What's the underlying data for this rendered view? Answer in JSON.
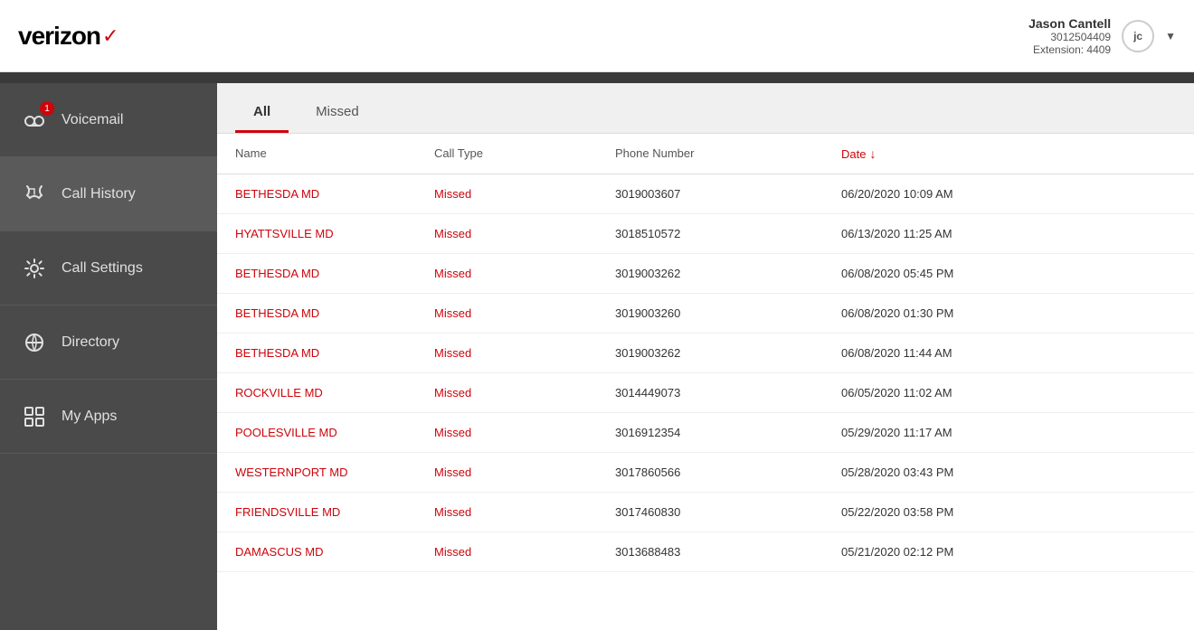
{
  "header": {
    "logo_text": "verizon",
    "user_name": "Jason Cantell",
    "user_phone": "3012504409",
    "user_ext": "Extension: 4409",
    "avatar_initials": "jc"
  },
  "sidebar": {
    "items": [
      {
        "id": "voicemail",
        "label": "Voicemail",
        "badge": "1",
        "active": false
      },
      {
        "id": "call-history",
        "label": "Call History",
        "badge": null,
        "active": true
      },
      {
        "id": "call-settings",
        "label": "Call Settings",
        "badge": null,
        "active": false
      },
      {
        "id": "directory",
        "label": "Directory",
        "badge": null,
        "active": false
      },
      {
        "id": "my-apps",
        "label": "My Apps",
        "badge": null,
        "active": false
      }
    ]
  },
  "tabs": [
    {
      "id": "all",
      "label": "All",
      "active": true
    },
    {
      "id": "missed",
      "label": "Missed",
      "active": false
    }
  ],
  "table": {
    "columns": [
      {
        "id": "name",
        "label": "Name",
        "sortable": false
      },
      {
        "id": "call_type",
        "label": "Call Type",
        "sortable": false
      },
      {
        "id": "phone_number",
        "label": "Phone Number",
        "sortable": false
      },
      {
        "id": "date",
        "label": "Date",
        "sortable": true,
        "sort_direction": "desc"
      }
    ],
    "rows": [
      {
        "name": "BETHESDA MD",
        "call_type": "Missed",
        "phone": "3019003607",
        "date": "06/20/2020 10:09 AM"
      },
      {
        "name": "HYATTSVILLE MD",
        "call_type": "Missed",
        "phone": "3018510572",
        "date": "06/13/2020 11:25 AM"
      },
      {
        "name": "BETHESDA MD",
        "call_type": "Missed",
        "phone": "3019003262",
        "date": "06/08/2020 05:45 PM"
      },
      {
        "name": "BETHESDA MD",
        "call_type": "Missed",
        "phone": "3019003260",
        "date": "06/08/2020 01:30 PM"
      },
      {
        "name": "BETHESDA MD",
        "call_type": "Missed",
        "phone": "3019003262",
        "date": "06/08/2020 11:44 AM"
      },
      {
        "name": "ROCKVILLE MD",
        "call_type": "Missed",
        "phone": "3014449073",
        "date": "06/05/2020 11:02 AM"
      },
      {
        "name": "POOLESVILLE MD",
        "call_type": "Missed",
        "phone": "3016912354",
        "date": "05/29/2020 11:17 AM"
      },
      {
        "name": "WESTERNPORT MD",
        "call_type": "Missed",
        "phone": "3017860566",
        "date": "05/28/2020 03:43 PM"
      },
      {
        "name": "FRIENDSVILLE MD",
        "call_type": "Missed",
        "phone": "3017460830",
        "date": "05/22/2020 03:58 PM"
      },
      {
        "name": "DAMASCUS MD",
        "call_type": "Missed",
        "phone": "3013688483",
        "date": "05/21/2020 02:12 PM"
      }
    ]
  },
  "colors": {
    "accent": "#cd040b",
    "sidebar_bg": "#4a4a4a",
    "sidebar_active": "#5a5a5a"
  }
}
